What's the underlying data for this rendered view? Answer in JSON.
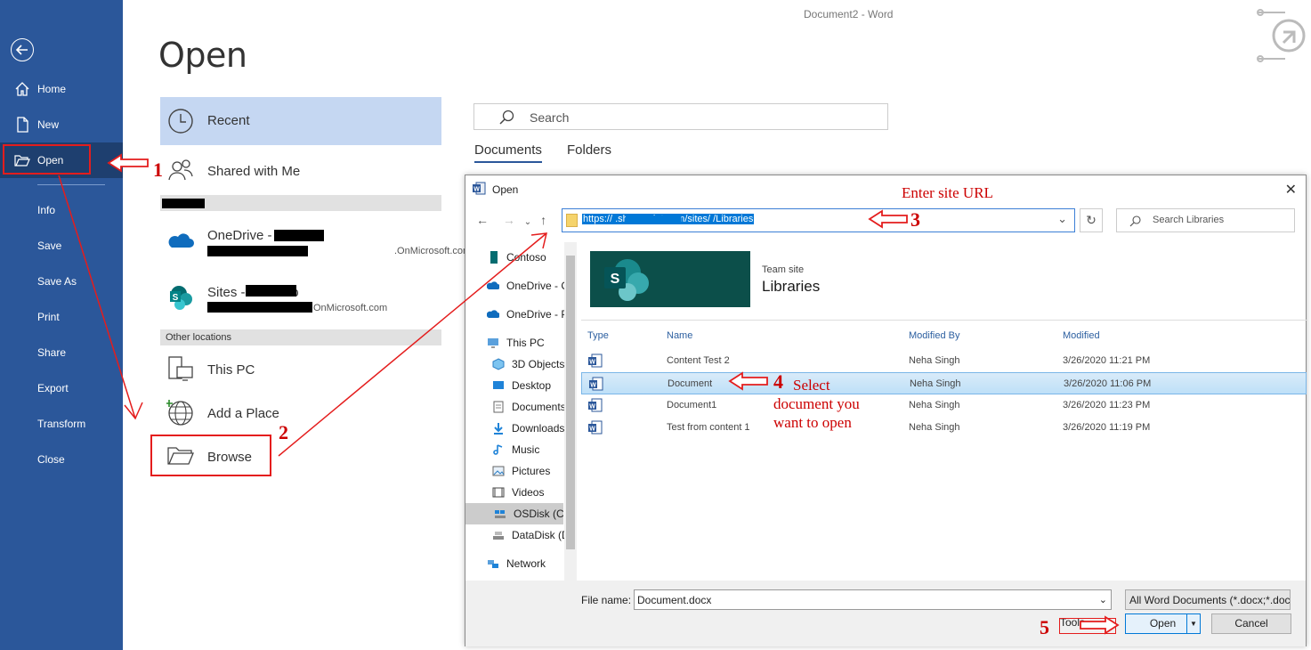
{
  "window": {
    "title": "Document2  -  Word"
  },
  "sidebar": {
    "items": [
      {
        "label": "Home",
        "icon": "home-icon"
      },
      {
        "label": "New",
        "icon": "new-document-icon"
      },
      {
        "label": "Open",
        "icon": "open-folder-icon"
      },
      {
        "label": "Info"
      },
      {
        "label": "Save"
      },
      {
        "label": "Save As"
      },
      {
        "label": "Print"
      },
      {
        "label": "Share"
      },
      {
        "label": "Export"
      },
      {
        "label": "Transform"
      },
      {
        "label": "Close"
      }
    ]
  },
  "page": {
    "title": "Open"
  },
  "locations": {
    "recent": "Recent",
    "shared": "Shared with Me",
    "onedrive": {
      "label": "OneDrive - ",
      "sub": ".OnMicrosoft.com"
    },
    "sites": {
      "label": "Sites - Contoso",
      "sub": "OnMicrosoft.com"
    },
    "other_header": "Other locations",
    "this_pc": "This PC",
    "add_place": "Add a Place",
    "browse": "Browse"
  },
  "search": {
    "placeholder": "Search"
  },
  "tabs": [
    "Documents",
    "Folders"
  ],
  "dialog": {
    "title": "Open",
    "address": "https://                    .sharepoint.com/sites/          /Libraries",
    "search_placeholder": "Search Libraries",
    "tree": [
      {
        "label": "Contoso",
        "icon": "sharepoint-icon"
      },
      {
        "label": "OneDrive - C",
        "icon": "onedrive-icon"
      },
      {
        "label": "OneDrive - P",
        "icon": "onedrive-icon"
      },
      {
        "label": "This PC",
        "icon": "computer-icon"
      },
      {
        "label": "3D Objects",
        "icon": "3d-objects-icon"
      },
      {
        "label": "Desktop",
        "icon": "desktop-icon"
      },
      {
        "label": "Documents",
        "icon": "documents-icon"
      },
      {
        "label": "Downloads",
        "icon": "downloads-icon"
      },
      {
        "label": "Music",
        "icon": "music-icon"
      },
      {
        "label": "Pictures",
        "icon": "pictures-icon"
      },
      {
        "label": "Videos",
        "icon": "videos-icon"
      },
      {
        "label": "OSDisk (C:)",
        "icon": "disk-icon"
      },
      {
        "label": "DataDisk (D:)",
        "icon": "disk-icon"
      },
      {
        "label": "Network",
        "icon": "network-icon"
      }
    ],
    "banner": {
      "subtitle": "Team site",
      "title": "Libraries",
      "letter": "S"
    },
    "columns": [
      "Type",
      "Name",
      "Modified By",
      "Modified"
    ],
    "files": [
      {
        "name": "Content Test 2",
        "modified_by": "Neha Singh",
        "modified": "3/26/2020 11:21 PM"
      },
      {
        "name": "Document",
        "modified_by": "Neha Singh",
        "modified": "3/26/2020 11:06 PM"
      },
      {
        "name": "Document1",
        "modified_by": "Neha Singh",
        "modified": "3/26/2020 11:23 PM"
      },
      {
        "name": "Test from content 1",
        "modified_by": "Neha Singh",
        "modified": "3/26/2020 11:19 PM"
      }
    ],
    "file_name_label": "File name:",
    "file_name": "Document.docx",
    "file_type": "All Word Documents (*.docx;*.docm;*.dotx)",
    "tools": "Tools",
    "open": "Open",
    "cancel": "Cancel"
  },
  "annotations": {
    "n1": "1",
    "n2": "2",
    "n3": "3",
    "n4": "4",
    "n5": "5",
    "enter_url": "Enter site URL",
    "select_doc": "Select document you want to open",
    "color": "#e41d1d"
  }
}
